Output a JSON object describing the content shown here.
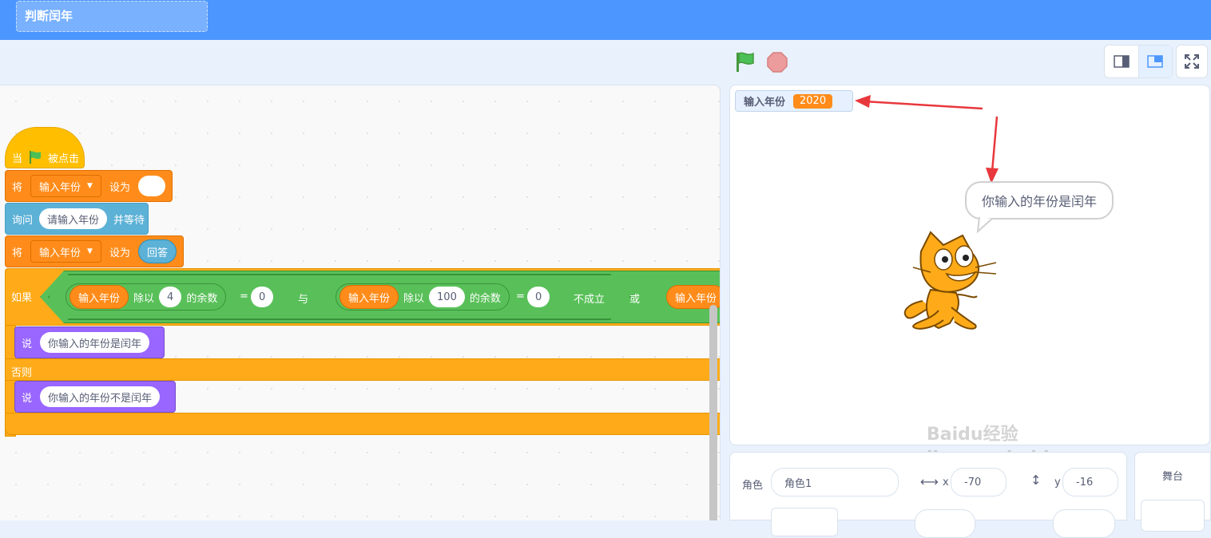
{
  "header": {
    "project_title": "判断闰年"
  },
  "stage_controls": {
    "flag_icon": "green-flag-icon",
    "stop_icon": "stop-icon"
  },
  "blocks": {
    "when": "当",
    "clicked": "被点击",
    "set1_prefix": "将",
    "set1_var": "输入年份",
    "set1_to": "设为",
    "ask": "询问",
    "ask_prompt": "请输入年份",
    "ask_wait": "并等待",
    "set2_prefix": "将",
    "set2_var": "输入年份",
    "set2_to": "设为",
    "answer": "回答",
    "if": "如果",
    "var_a": "输入年份",
    "mod_a": "除以",
    "mod_a_val": "4",
    "rem_a": "的余数",
    "eq_a": "=",
    "eq_a_val": "0",
    "and": "与",
    "var_b": "输入年份",
    "mod_b": "除以",
    "mod_b_val": "100",
    "rem_b": "的余数",
    "eq_b": "=",
    "eq_b_val": "0",
    "not_true": "不成立",
    "or": "或",
    "var_c": "输入年份",
    "say1": "说",
    "say1_text": "你输入的年份是闰年",
    "else": "否则",
    "say2": "说",
    "say2_text": "你输入的年份不是闰年"
  },
  "stage": {
    "monitor_label": "输入年份",
    "monitor_value": "2020",
    "speech": "你输入的年份是闰年",
    "watermark": "Baidu经验 jingyan.baidu.com"
  },
  "sprite_info": {
    "sprite_label": "角色",
    "sprite_name": "角色1",
    "x_label": "x",
    "x_value": "-70",
    "y_label": "y",
    "y_value": "-16",
    "stage_label": "舞台"
  },
  "colors": {
    "accent": "#4c97ff",
    "events": "#ffbf00",
    "variables": "#ff8c1a",
    "sensing": "#5cb1d6",
    "control": "#ffab19",
    "operators": "#59c059",
    "looks": "#9966ff"
  }
}
